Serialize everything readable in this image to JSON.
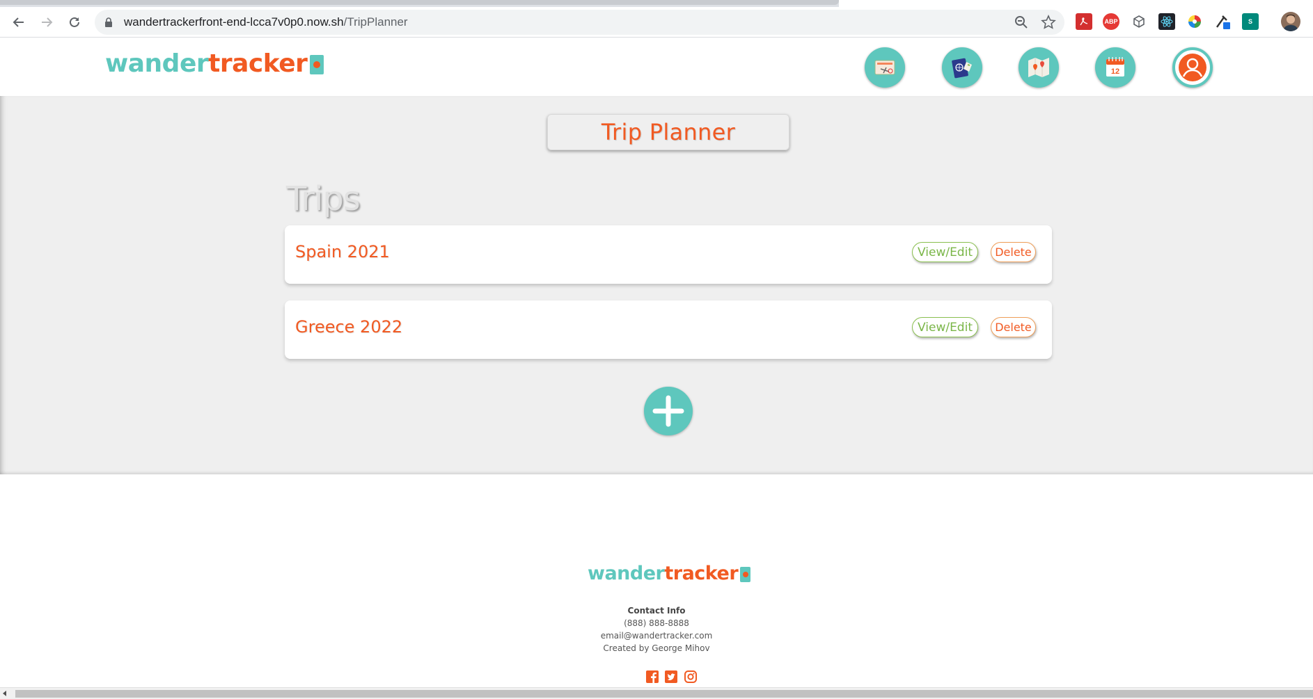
{
  "browser": {
    "url_host": "wandertrackerfront-end-lcca7v0p0.now.sh",
    "url_path": "/TripPlanner",
    "extensions": [
      "pdf-extension-icon",
      "adblock-plus-icon",
      "cube-extension-icon",
      "react-devtools-icon",
      "color-picker-icon",
      "eyedropper-icon",
      "s-extension-icon"
    ],
    "ext_labels": {
      "adblock": "ABP",
      "s": "S"
    }
  },
  "header": {
    "logo_part1": "wander",
    "logo_part2": "tracker",
    "nav": [
      "flight-tickets-icon",
      "passport-icon",
      "map-icon",
      "calendar-icon",
      "profile-icon"
    ],
    "calendar_day": "12"
  },
  "main": {
    "page_title": "Trip Planner",
    "section_heading": "Trips",
    "trips": [
      {
        "name": "Spain 2021",
        "view_label": "View/Edit",
        "delete_label": "Delete"
      },
      {
        "name": "Greece 2022",
        "view_label": "View/Edit",
        "delete_label": "Delete"
      }
    ]
  },
  "footer": {
    "logo_part1": "wander",
    "logo_part2": "tracker",
    "contact_heading": "Contact Info",
    "phone": "(888) 888-8888",
    "email": "email@wandertracker.com",
    "credit": "Created by George Mihov",
    "social": [
      "facebook-icon",
      "twitter-icon",
      "instagram-icon"
    ]
  },
  "colors": {
    "teal": "#5ec7bd",
    "orange": "#f15a22",
    "green": "#8cc152",
    "background": "#efefef"
  }
}
